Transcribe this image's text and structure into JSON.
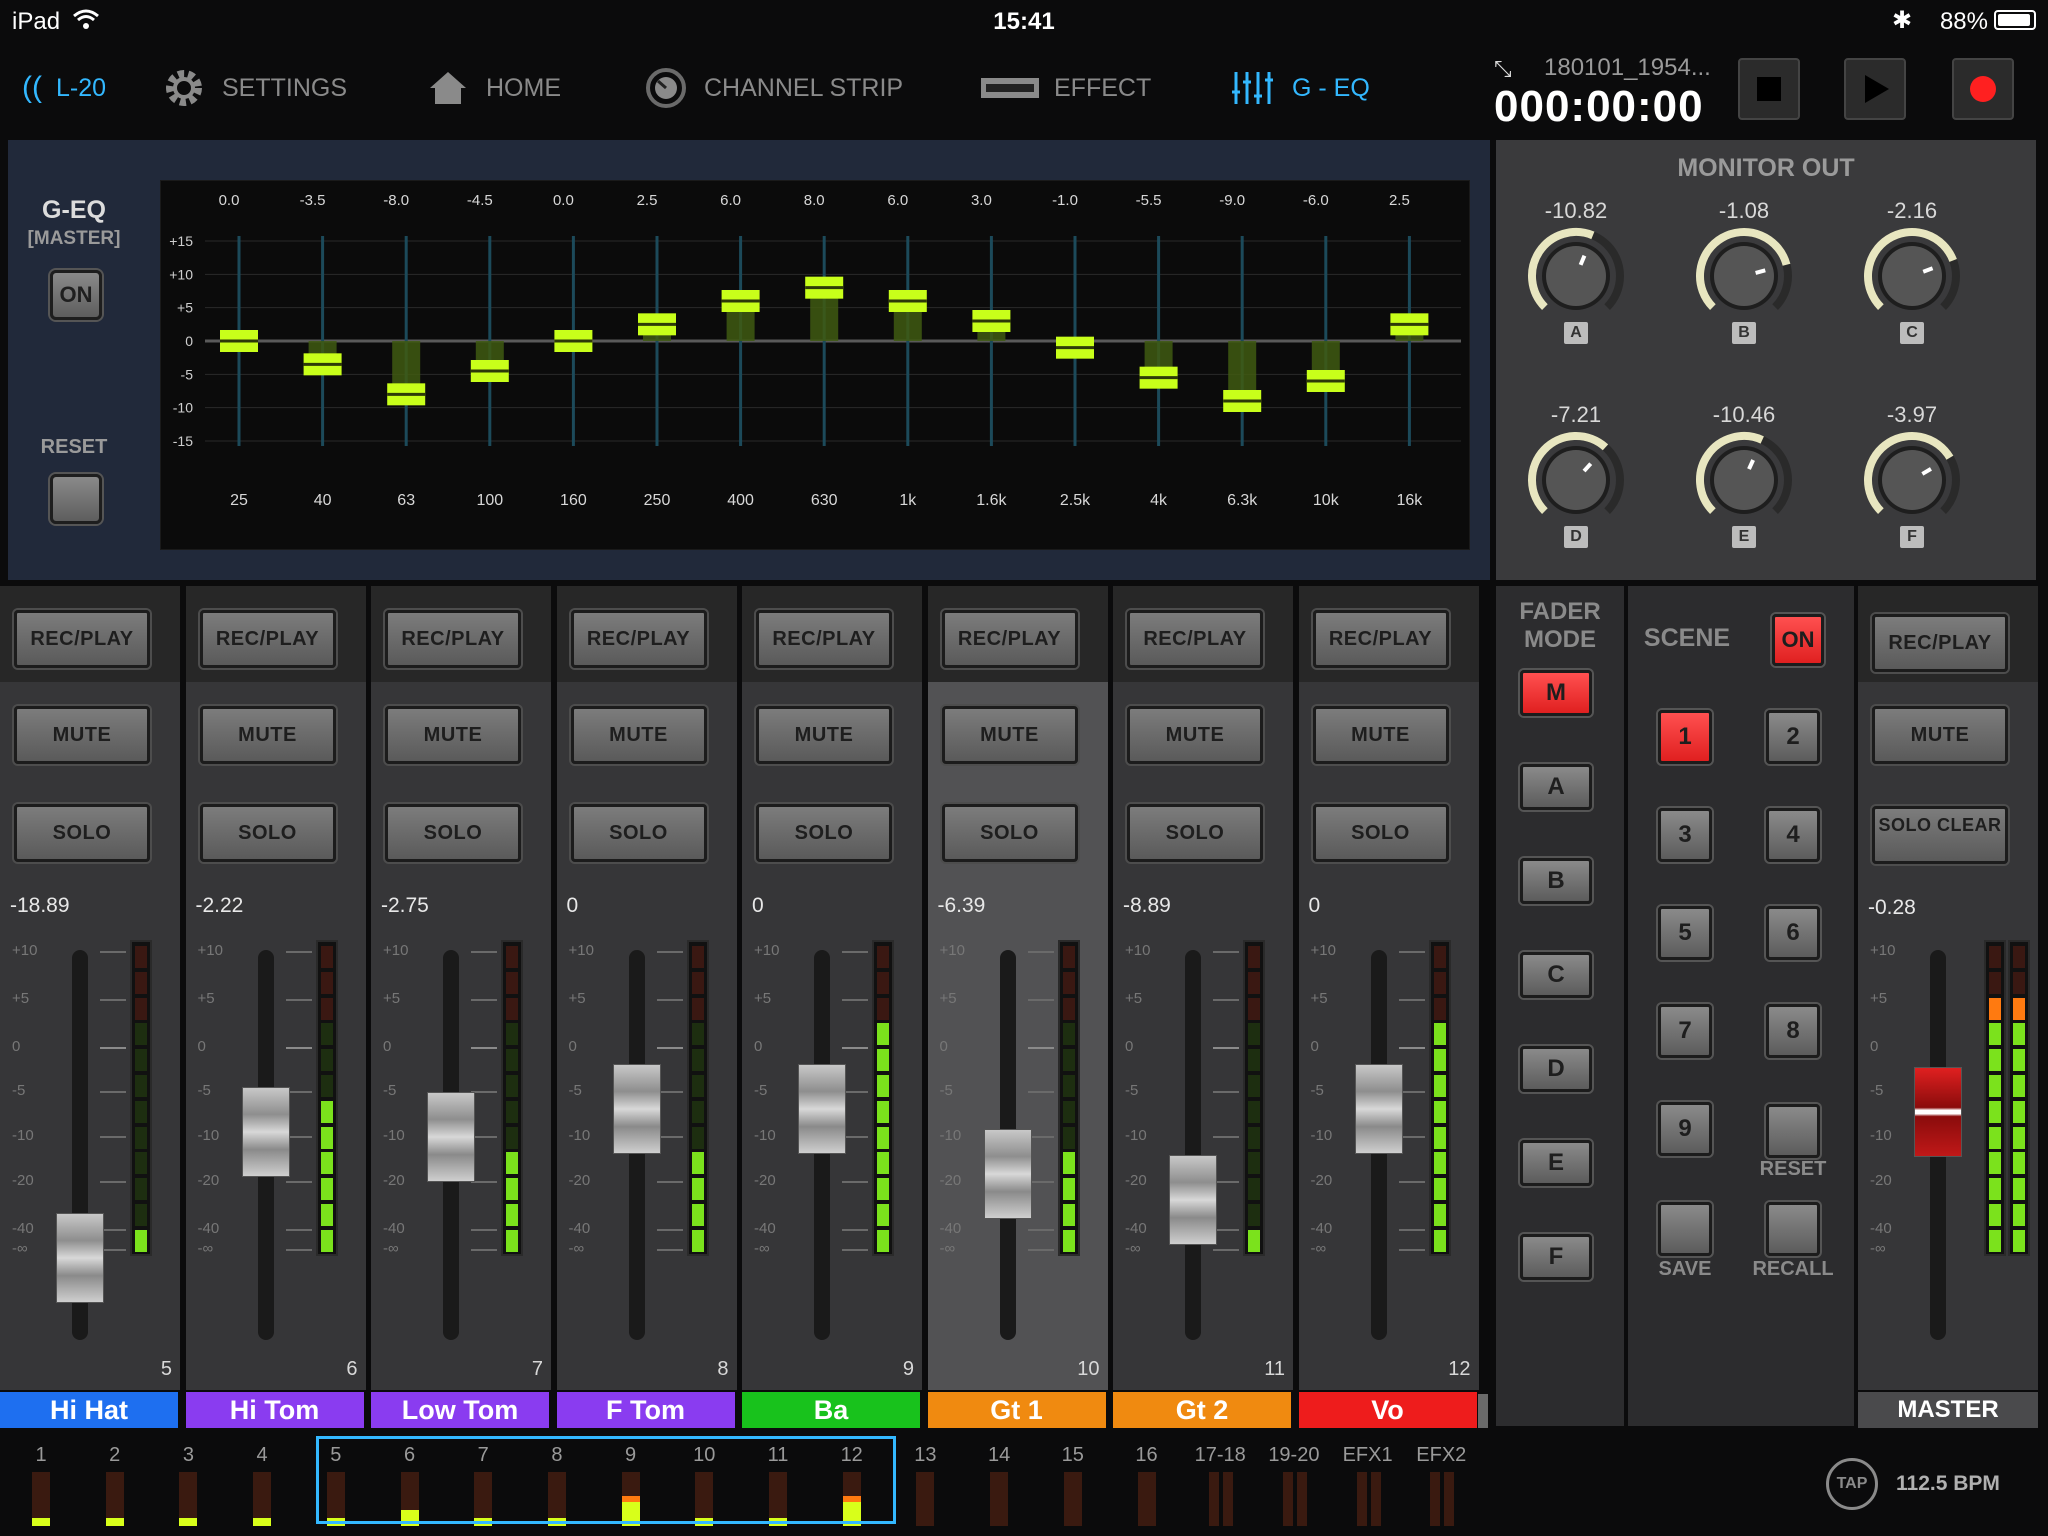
{
  "status": {
    "device": "iPad",
    "time": "15:41",
    "battery": "88%"
  },
  "nav": {
    "brand": "L-20",
    "items": [
      "SETTINGS",
      "HOME",
      "CHANNEL STRIP",
      "EFFECT",
      "G - EQ"
    ]
  },
  "transport": {
    "file": "180101_1954...",
    "counter": "000:00:00"
  },
  "geq": {
    "title": "G-EQ",
    "subtitle": "[MASTER]",
    "on_label": "ON",
    "reset_label": "RESET",
    "y_ticks": [
      "+15",
      "+10",
      "+5",
      "0",
      "-5",
      "-10",
      "-15"
    ],
    "bands": [
      {
        "freq": "25",
        "gain": "0.0",
        "value": 0.0
      },
      {
        "freq": "40",
        "gain": "-3.5",
        "value": -3.5
      },
      {
        "freq": "63",
        "gain": "-8.0",
        "value": -8.0
      },
      {
        "freq": "100",
        "gain": "-4.5",
        "value": -4.5
      },
      {
        "freq": "160",
        "gain": "0.0",
        "value": 0.0
      },
      {
        "freq": "250",
        "gain": "2.5",
        "value": 2.5
      },
      {
        "freq": "400",
        "gain": "6.0",
        "value": 6.0
      },
      {
        "freq": "630",
        "gain": "8.0",
        "value": 8.0
      },
      {
        "freq": "1k",
        "gain": "6.0",
        "value": 6.0
      },
      {
        "freq": "1.6k",
        "gain": "3.0",
        "value": 3.0
      },
      {
        "freq": "2.5k",
        "gain": "-1.0",
        "value": -1.0
      },
      {
        "freq": "4k",
        "gain": "-5.5",
        "value": -5.5
      },
      {
        "freq": "6.3k",
        "gain": "-9.0",
        "value": -9.0
      },
      {
        "freq": "10k",
        "gain": "-6.0",
        "value": -6.0
      },
      {
        "freq": "16k",
        "gain": "2.5",
        "value": 2.5
      }
    ]
  },
  "monitor": {
    "title": "MONITOR OUT",
    "knobs": [
      {
        "label": "A",
        "value": "-10.82",
        "level": -10.82
      },
      {
        "label": "B",
        "value": "-1.08",
        "level": -1.08
      },
      {
        "label": "C",
        "value": "-2.16",
        "level": -2.16
      },
      {
        "label": "D",
        "value": "-7.21",
        "level": -7.21
      },
      {
        "label": "E",
        "value": "-10.46",
        "level": -10.46
      },
      {
        "label": "F",
        "value": "-3.97",
        "level": -3.97
      }
    ]
  },
  "buttons": {
    "recplay": "REC/PLAY",
    "mute": "MUTE",
    "solo": "SOLO",
    "solo_clear": "SOLO CLEAR"
  },
  "fader_scale": [
    "+10",
    "+5",
    "0",
    "-5",
    "-10",
    "-20",
    "-40",
    "-∞"
  ],
  "channels": [
    {
      "num": "5",
      "name": "Hi Hat",
      "level": "-18.89",
      "fader": -18.89,
      "color": "#1e6ff0",
      "meter": 1
    },
    {
      "num": "6",
      "name": "Hi Tom",
      "level": "-2.22",
      "fader": -2.22,
      "color": "#8a3cf0",
      "meter": 6
    },
    {
      "num": "7",
      "name": "Low Tom",
      "level": "-2.75",
      "fader": -2.75,
      "color": "#8a3cf0",
      "meter": 4
    },
    {
      "num": "8",
      "name": "F Tom",
      "level": "0",
      "fader": 0,
      "color": "#8a3cf0",
      "meter": 4
    },
    {
      "num": "9",
      "name": "Ba",
      "level": "0",
      "fader": 0,
      "color": "#18c21c",
      "meter": 9
    },
    {
      "num": "10",
      "name": "Gt 1",
      "level": "-6.39",
      "fader": -6.39,
      "color": "#f08a10",
      "meter": 4
    },
    {
      "num": "11",
      "name": "Gt 2",
      "level": "-8.89",
      "fader": -8.89,
      "color": "#f08a10",
      "meter": 1
    },
    {
      "num": "12",
      "name": "Vo",
      "level": "0",
      "fader": 0,
      "color": "#ee1c1c",
      "meter": 9
    }
  ],
  "fader_mode": {
    "title": "FADER MODE",
    "items": [
      "M",
      "A",
      "B",
      "C",
      "D",
      "E",
      "F"
    ]
  },
  "scene": {
    "title": "SCENE",
    "on_label": "ON",
    "numbers": [
      "1",
      "2",
      "3",
      "4",
      "5",
      "6",
      "7",
      "8",
      "9"
    ],
    "reset_label": "RESET",
    "save_label": "SAVE",
    "recall_label": "RECALL"
  },
  "master": {
    "name": "MASTER",
    "level": "-0.28",
    "fader": -0.28
  },
  "bottom": {
    "channels": [
      "1",
      "2",
      "3",
      "4",
      "5",
      "6",
      "7",
      "8",
      "9",
      "10",
      "11",
      "12",
      "13",
      "14",
      "15",
      "16",
      "17-18",
      "19-20",
      "EFX1",
      "EFX2"
    ],
    "tap_label": "TAP",
    "bpm": "112.5 BPM"
  },
  "colors": {
    "accent": "#33b8ff",
    "eq_band": "#c8ff1a",
    "record": "#ff2020"
  }
}
